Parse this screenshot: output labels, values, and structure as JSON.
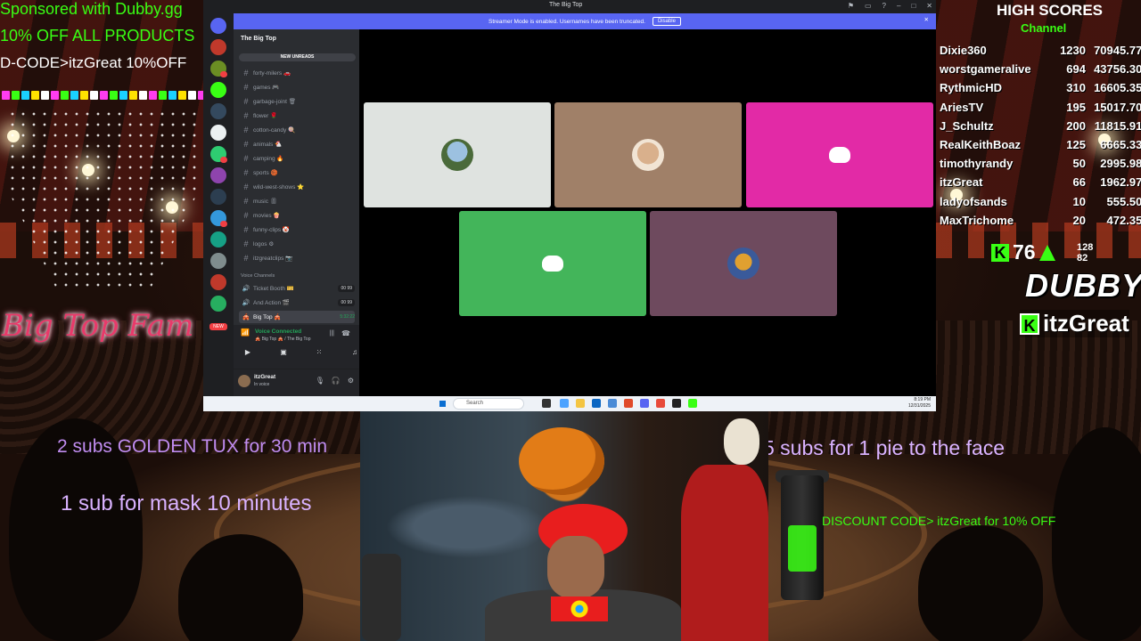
{
  "overlay": {
    "sponsor_line1": "Sponsored with Dubby.gg",
    "sponsor_line2": "10% OFF ALL PRODUCTS",
    "sponsor_line3": "D-CODE>itzGreat 10%OFF",
    "big_top_fam": "Big Top Fam",
    "sub_goal1": "2 subs GOLDEN TUX for 30 min",
    "sub_goal2": "1 sub for mask 10 minutes",
    "sub_goal3": "5 subs for 1 pie to the face",
    "discount_code": "DISCOUNT CODE> itzGreat for 10% OFF",
    "ticker_colors": [
      "#ff3cf0",
      "#39ff14",
      "#1ad1ff",
      "#ffe200",
      "#ffffff",
      "#ff3cf0",
      "#39ff14",
      "#1ad1ff",
      "#ffe200",
      "#ffffff",
      "#ff3cf0",
      "#39ff14",
      "#1ad1ff",
      "#ffe200",
      "#ffffff",
      "#ff3cf0",
      "#39ff14",
      "#1ad1ff",
      "#ffe200",
      "#ffffff",
      "#ff3cf0",
      "#39ff14"
    ]
  },
  "high_scores": {
    "title": "HIGH SCORES",
    "subtitle": "Channel",
    "rows": [
      {
        "name": "Dixie360",
        "a": "1230",
        "b": "7094",
        "c": "5.77"
      },
      {
        "name": "worstgameralive",
        "a": "694",
        "b": "4375",
        "c": "6.30"
      },
      {
        "name": "RythmicHD",
        "a": "310",
        "b": "1660",
        "c": "5.35"
      },
      {
        "name": "AriesTV",
        "a": "195",
        "b": "1501",
        "c": "7.70"
      },
      {
        "name": "J_Schultz",
        "a": "200",
        "b": "1181",
        "c": "5.91"
      },
      {
        "name": "RealKeithBoaz",
        "a": "125",
        "b": "666",
        "c": "5.33"
      },
      {
        "name": "timothyrandy",
        "a": "50",
        "b": "299",
        "c": "5.98"
      },
      {
        "name": "itzGreat",
        "a": "66",
        "b": "196",
        "c": "2.97"
      },
      {
        "name": "ladyofsands",
        "a": "10",
        "b": "55",
        "c": "5.50"
      },
      {
        "name": "MaxTrichome",
        "a": "20",
        "b": "47",
        "c": "2.35"
      }
    ]
  },
  "kick": {
    "badge": "K",
    "viewer_count": "76",
    "stat_top": "128",
    "stat_bottom": "82",
    "brand": "DUBBY",
    "channel": "itzGreat"
  },
  "discord": {
    "window_title": "The Big Top",
    "streamer_banner": "Streamer Mode is enabled. Usernames have been truncated.",
    "disable_label": "Disable",
    "server_name": "The Big Top",
    "new_unreads": "NEW UNREADS",
    "channels": [
      "forty-milers 🚗",
      "games 🎮",
      "garbage-joint 🗑",
      "flower 🌹",
      "cotton-candy 🍭",
      "animals 🐔",
      "camping 🔥",
      "sports 🏀",
      "wild-west-shows ⭐",
      "music 🎚",
      "movies 🍿",
      "funny-clips 🤡",
      "logos ⚙",
      "itzgreatclips 📷"
    ],
    "voice_header": "Voice Channels",
    "voice_channels": [
      {
        "name": "Ticket Booth 🎫",
        "count": "00 99"
      },
      {
        "name": "And Action 🎬",
        "count": "00 99"
      },
      {
        "name": "Big Top 🎪",
        "timer": "5:32:22"
      }
    ],
    "voice_connected": "Voice Connected",
    "voice_location": "🎪 Big Top 🎪 / The Big Top",
    "username": "itzGreat",
    "user_status": "In voice",
    "new_badge": "NEW",
    "taskbar_search": "Search",
    "tray_time": "8:19 PM",
    "tray_date": "12/31/2025",
    "tile_colors": [
      "#dfe3e0",
      "#a08068",
      "#e22aa6",
      "#43b55a",
      "#6e4a5e"
    ]
  }
}
